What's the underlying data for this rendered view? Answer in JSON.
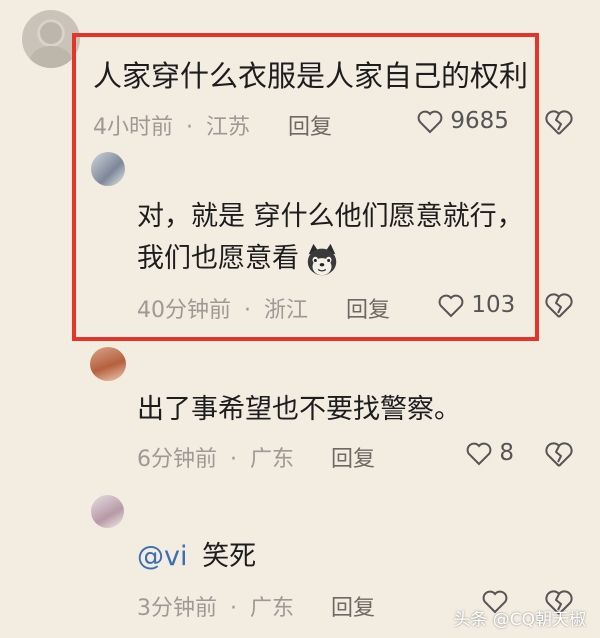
{
  "comments": [
    {
      "text": "人家穿什么衣服是人家自己的权利",
      "time": "4小时前",
      "region": "江苏",
      "reply_label": "回复",
      "likes": "9685"
    },
    {
      "line1": "对，就是 穿什么他们愿意就行，",
      "line2": "我们也愿意看",
      "time": "40分钟前",
      "region": "浙江",
      "reply_label": "回复",
      "likes": "103",
      "emoji": "husky-face"
    },
    {
      "text": "出了事希望也不要找警察。",
      "time": "6分钟前",
      "region": "广东",
      "reply_label": "回复",
      "likes": "8"
    },
    {
      "mention": "@vi",
      "text": "笑死",
      "time": "3分钟前",
      "region": "广东",
      "reply_label": "回复"
    }
  ],
  "separator": "·",
  "watermark": "头条 @CQ朝天椒",
  "colors": {
    "highlight": "#e5352b",
    "background": "#f2ece1"
  },
  "icons": [
    "heart-icon",
    "broken-heart-icon",
    "avatar"
  ]
}
